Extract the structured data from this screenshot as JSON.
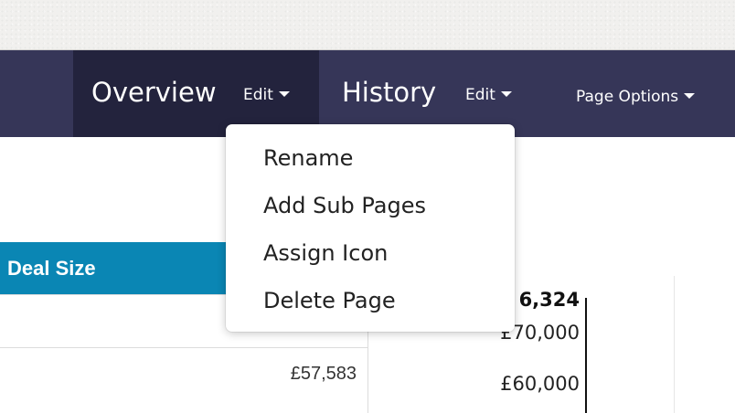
{
  "nav": {
    "tabs": [
      {
        "title": "Overview",
        "edit_label": "Edit"
      },
      {
        "title": "History",
        "edit_label": "Edit"
      }
    ],
    "page_options_label": "Page Options",
    "colors": {
      "bar": "#363658",
      "active_tab": "#23233d"
    }
  },
  "dropdown_menu": {
    "items": [
      "Rename",
      "Add Sub Pages",
      "Assign Icon",
      "Delete Page"
    ]
  },
  "table": {
    "header": "Deal Size",
    "header_color": "#0a86b4",
    "rows": [
      "£57,583"
    ]
  },
  "chart_axis": {
    "partial_top_value": "6,324",
    "labels": [
      "£70,000",
      "£60,000"
    ]
  }
}
